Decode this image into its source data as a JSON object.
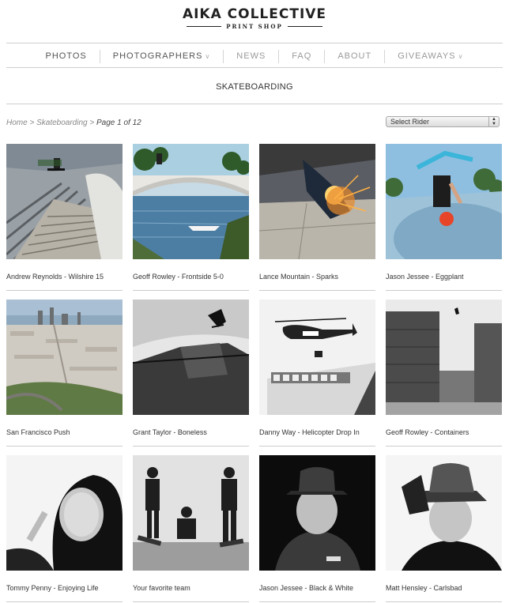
{
  "brand": {
    "title": "AIKA COLLECTIVE",
    "subtitle": "PRINT SHOP"
  },
  "nav": [
    {
      "label": "PHOTOS",
      "chevron": false
    },
    {
      "label": "PHOTOGRAPHERS",
      "chevron": true
    },
    {
      "label": "NEWS",
      "chevron": false
    },
    {
      "label": "FAQ",
      "chevron": false
    },
    {
      "label": "ABOUT",
      "chevron": false
    },
    {
      "label": "GIVEAWAYS",
      "chevron": true
    }
  ],
  "chevron_glyph": "∨",
  "section": {
    "title": "SKATEBOARDING"
  },
  "breadcrumb": {
    "home": "Home",
    "sep1": " > ",
    "category": "Skateboarding",
    "sep2": " > ",
    "current": "Page 1 of 12"
  },
  "rider_select": {
    "selected": "Select Rider"
  },
  "photos": [
    {
      "caption": "Andrew Reynolds - Wilshire 15",
      "icon": "stairs-photo-icon"
    },
    {
      "caption": "Geoff Rowley - Frontside 5-0",
      "icon": "bridge-photo-icon"
    },
    {
      "caption": "Lance Mountain - Sparks",
      "icon": "sparks-photo-icon"
    },
    {
      "caption": "Jason Jessee - Eggplant",
      "icon": "pool-photo-icon"
    },
    {
      "caption": "San Francisco Push",
      "icon": "city-photo-icon"
    },
    {
      "caption": "Grant Taylor - Boneless",
      "icon": "ramp-photo-icon"
    },
    {
      "caption": "Danny Way - Helicopter Drop In",
      "icon": "helicopter-photo-icon"
    },
    {
      "caption": "Geoff Rowley - Containers",
      "icon": "containers-photo-icon"
    },
    {
      "caption": "Tommy Penny - Enjoying Life",
      "icon": "portrait-photo-icon"
    },
    {
      "caption": "Your favorite team",
      "icon": "team-photo-icon"
    },
    {
      "caption": "Jason Jessee - Black & White",
      "icon": "portrait-photo-icon"
    },
    {
      "caption": "Matt Hensley - Carlsbad",
      "icon": "portrait-photo-icon"
    }
  ]
}
